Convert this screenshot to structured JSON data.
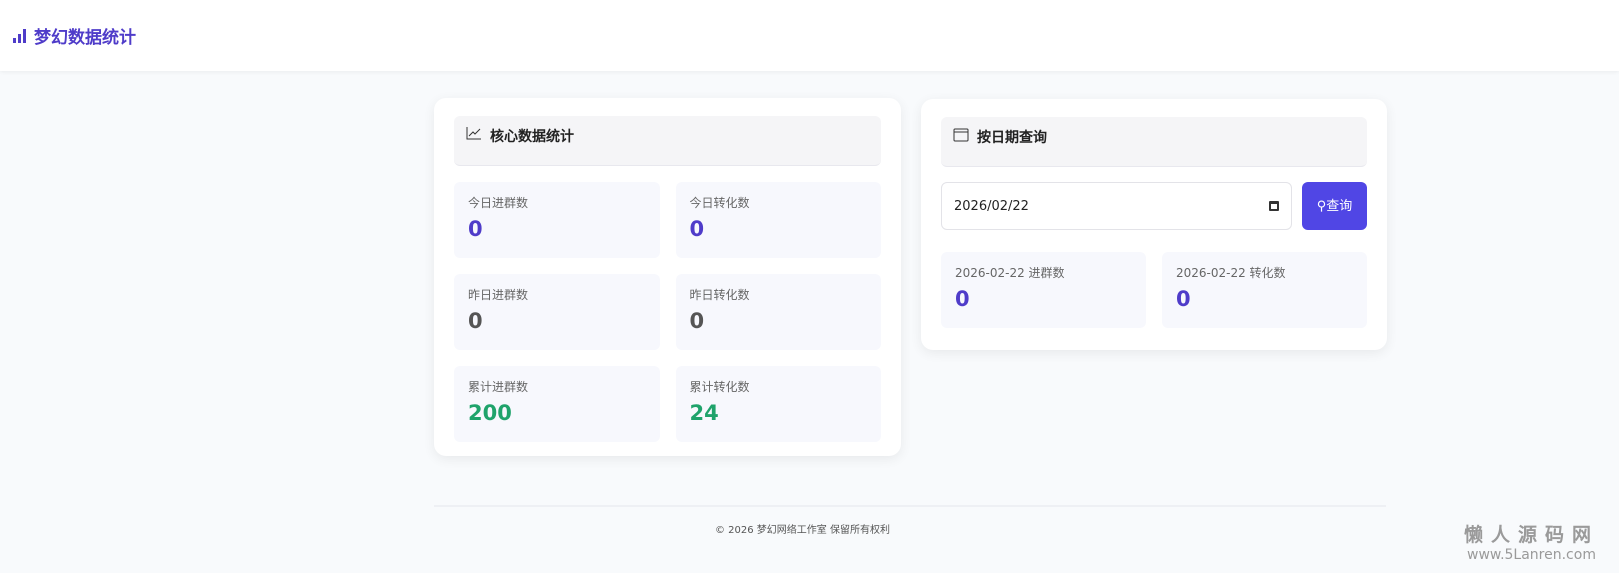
{
  "header": {
    "title": "梦幻数据统计",
    "icon": "bar-chart-icon"
  },
  "core": {
    "title": "核心数据统计",
    "icon": "line-chart-icon",
    "stats": [
      {
        "label": "今日进群数",
        "value": "0"
      },
      {
        "label": "今日转化数",
        "value": "0"
      },
      {
        "label": "昨日进群数",
        "value": "0"
      },
      {
        "label": "昨日转化数",
        "value": "0"
      },
      {
        "label": "累计进群数",
        "value": "200"
      },
      {
        "label": "累计转化数",
        "value": "24"
      }
    ]
  },
  "query": {
    "title": "按日期查询",
    "icon": "calendar-icon",
    "date_value": "2026/02/22",
    "button_label": "查询",
    "stats": [
      {
        "label": "2026-02-22 进群数",
        "value": "0"
      },
      {
        "label": "2026-02-22 转化数",
        "value": "0"
      }
    ]
  },
  "footer": {
    "text": "© 2026 梦幻网络工作室 保留所有权利"
  },
  "watermark": {
    "title": "懒人源码网",
    "url": "www.5Lanren.com"
  },
  "colors": {
    "accent": "#4f3cc9",
    "button": "#5046e5",
    "green": "#1fa36b"
  }
}
